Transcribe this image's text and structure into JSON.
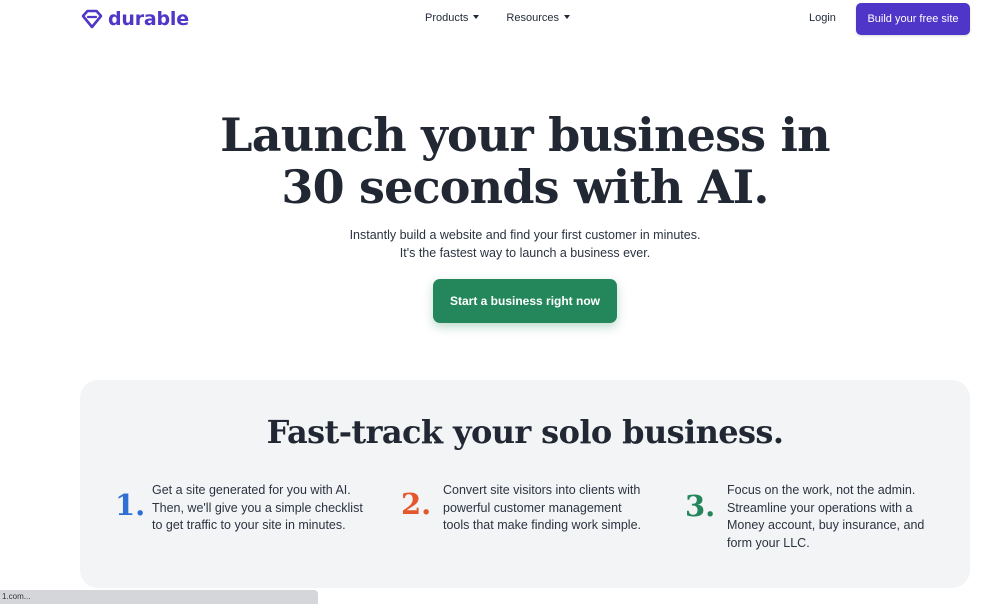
{
  "brand": {
    "name": "durable",
    "color": "#5137c8"
  },
  "nav": [
    {
      "label": "Products"
    },
    {
      "label": "Resources"
    }
  ],
  "header": {
    "login_label": "Login",
    "cta_label": "Build your free site"
  },
  "hero": {
    "title_line1": "Launch your business in",
    "title_line2": "30 seconds with AI.",
    "subtitle_line1": "Instantly build a website and find your first customer in minutes.",
    "subtitle_line2": "It's the fastest way to launch a business ever.",
    "cta_label": "Start a business right now",
    "cta_color": "#24875c"
  },
  "section": {
    "title": "Fast-track your solo business.",
    "steps": [
      {
        "number": "1.",
        "color": "#2f6fd4",
        "lines": [
          "Get a site generated for you with AI.",
          "Then, we'll give you a simple checklist",
          "to get traffic to your site in minutes."
        ]
      },
      {
        "number": "2.",
        "color": "#e4572e",
        "lines": [
          "Convert site visitors into clients with",
          "powerful customer management",
          "tools that make finding work simple."
        ]
      },
      {
        "number": "3.",
        "color": "#24875c",
        "lines": [
          "Focus on the work, not the admin.",
          "Streamline your operations with a",
          "Money account, buy insurance, and",
          "form your LLC."
        ]
      }
    ]
  },
  "status_bar": {
    "text": "1.com..."
  }
}
